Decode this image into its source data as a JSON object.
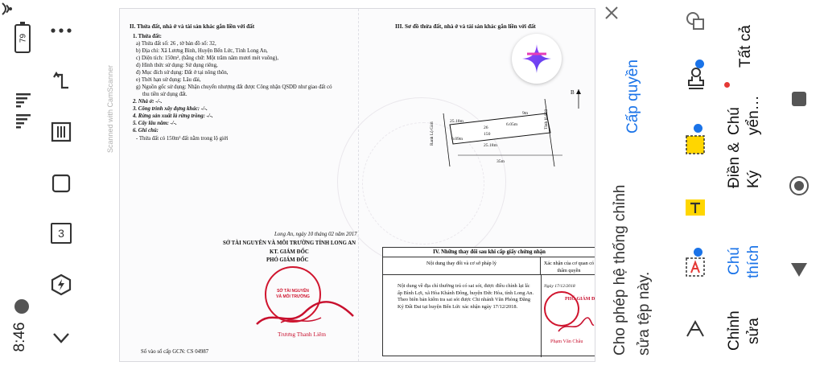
{
  "status_bar": {
    "battery": "79",
    "time": "8:46"
  },
  "toolbar": {
    "page_count_badge": "3"
  },
  "watermark": "Scanned with CamScanner",
  "document": {
    "left": {
      "section_title": "II. Thửa đất, nhà ở và tài sản khác gắn liền với đất",
      "line1": "1. Thửa đất:",
      "line_a": "a) Thửa đất số:   26          , tờ bản đồ số:         32,",
      "line_b": "b) Địa chỉ:   Xã Lương Bình, Huyện Bến Lức, Tỉnh Long An,",
      "line_c": "c) Diện tích:        150m², (bằng chữ: Một trăm năm mươi mét vuông),",
      "line_d": "d) Hình thức sử dụng:    Sử dụng riêng,",
      "line_dd": "đ) Mục đích sử dụng:   Đất ở tại nông thôn,",
      "line_e": "e) Thời hạn sử dụng:   Lâu dài,",
      "line_g": "g) Nguồn gốc sử dụng:  Nhận chuyển nhượng đất được Công nhận QSDĐ như giao đất có",
      "line_g2": "thu tiền sử dụng đất.",
      "line2": "2. Nhà ở: -/-.",
      "line3": "3. Công trình xây dựng khác: -/-.",
      "line4": "4. Rừng sản xuất là rừng trồng: -/-.",
      "line5": "5. Cây lâu năm: -/-.",
      "line6": "6. Ghi chú:",
      "line6a": "- Thửa đất có 150m² đất nằm trong lộ giới",
      "place_date": "Long An, ngày 10 tháng 02 năm 2017",
      "authority": "SỞ TÀI NGUYÊN VÀ MÔI TRƯỜNG TỈNH LONG AN",
      "kt": "KT. GIÁM ĐỐC",
      "deputy": "PHÓ GIÁM ĐỐC",
      "signer": "Trương Thanh Liêm",
      "stamp_text": "SỞ TÀI NGUYÊN VÀ MÔI TRƯỜNG",
      "register_no": "Số vào sổ cấp GCN: CS 04987"
    },
    "right": {
      "section_title": "III. Sơ đồ thửa đất, nhà ở và tài sản khác gắn liền với đất",
      "map": {
        "north": "B",
        "dim_top": "25.18m",
        "dim_bottom": "25.18m",
        "dim_right_top": "6.05m",
        "dim_left": "6.09m",
        "parcel_no": "26",
        "area": "150",
        "road_left": "Ranh Lộ Giới",
        "road_right": "Tỉnh lộ 830",
        "edge_top": "9m",
        "edge_bottom": "35m"
      },
      "table": {
        "title": "IV. Những thay đổi sau khi cấp giấy chứng nhận",
        "col1": "Nội dung thay đổi và cơ sở pháp lý",
        "col2": "Xác nhận của cơ quan có thẩm quyền",
        "date_stamp": "Ngày 17/12/2018",
        "stamp_label": "PHÓ GIÁM Đ",
        "signer": "Phạm Văn Châu",
        "content": "Nội dung về địa chỉ thường trú có sai sót, được điều chỉnh lại là: ấp Bình Lợi, xã Hòa Khánh Đông, huyện Đức Hòa, tỉnh Long An. Theo biên bản kiểm tra sai sót được Chi nhánh Văn Phòng Đăng Ký Đất Đai tại huyện Bến Lức xác nhận ngày 17/12/2018."
      }
    }
  },
  "permission": {
    "link": "Cấp quyền",
    "message_line1": "Cho phép hệ thống chỉnh",
    "message_line2": "sửa tệp này."
  },
  "right_tools": {
    "all": "Tất cả",
    "note_line1": "Chú",
    "note_line2": "yển…",
    "fill_line1": "Điền &",
    "fill_line2": "Ký",
    "comment_line1": "Chú",
    "comment_line2": "thích",
    "edit_line1": "Chỉnh",
    "edit_line2": "sửa"
  },
  "colors": {
    "accent": "#1a73e8",
    "stamp_red": "#d0152e",
    "logo_purple": "#7b3fe4"
  }
}
